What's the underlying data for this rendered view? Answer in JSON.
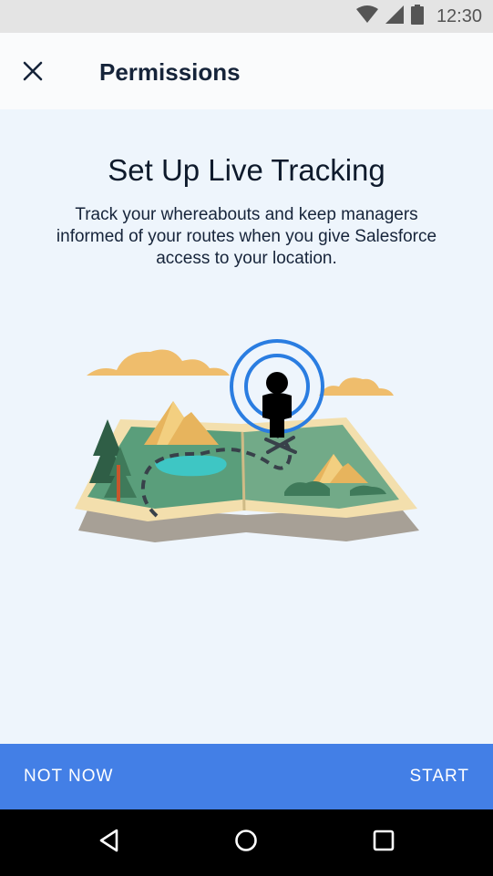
{
  "status_bar": {
    "time": "12:30",
    "icons": [
      "wifi-icon",
      "cellular-signal-icon",
      "battery-icon"
    ]
  },
  "app_bar": {
    "title": "Permissions",
    "close_icon": "close-icon"
  },
  "content": {
    "headline": "Set Up Live Tracking",
    "description": "Track your whereabouts and keep managers informed of your routes when you give Salesforce access to your location."
  },
  "actions": {
    "not_now_label": "NOT NOW",
    "start_label": "START"
  },
  "nav_bar": {
    "icons": [
      "back-icon",
      "home-icon",
      "recents-icon"
    ]
  },
  "colors": {
    "accent": "#437fe6",
    "background": "#eef5fc",
    "title_text": "#16243a"
  }
}
